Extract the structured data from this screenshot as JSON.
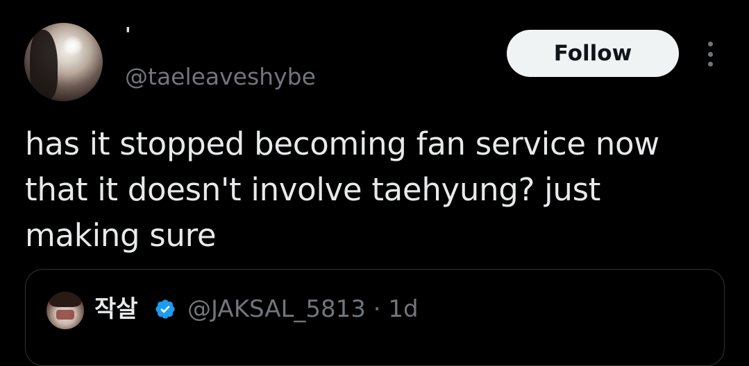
{
  "tweet": {
    "author": {
      "display_name": "'",
      "handle": "@taeleaveshybe",
      "avatar_icon": "profile-photo"
    },
    "follow_label": "Follow",
    "more_icon": "more-horizontal-icon",
    "text": "has it stopped becoming fan service now\nthat it doesn't involve taehyung? just\nmaking sure"
  },
  "quote": {
    "author": {
      "display_name": "작살",
      "verified": true,
      "handle": "@JAKSAL_5813",
      "separator": "·",
      "time": "1d"
    }
  },
  "colors": {
    "background": "#000000",
    "text_primary": "#e7e9ea",
    "text_secondary": "#71767b",
    "follow_bg": "#eff3f4",
    "follow_text": "#0f1419",
    "border": "#2f3336",
    "verified_blue": "#1d9bf0"
  }
}
